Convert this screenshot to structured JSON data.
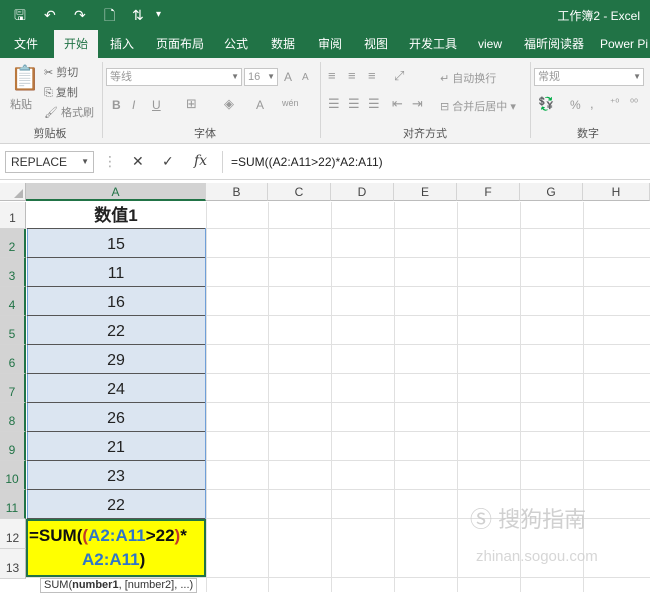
{
  "title": {
    "text": "工作簿2  -  Excel"
  },
  "tabs": [
    "文件",
    "开始",
    "插入",
    "页面布局",
    "公式",
    "数据",
    "审阅",
    "视图",
    "开发工具",
    "view",
    "福昕阅读器",
    "Power Pi"
  ],
  "ribbon": {
    "clipboard": {
      "paste": "粘贴",
      "cut": "剪切",
      "copy": "复制",
      "format_painter": "格式刷",
      "group": "剪贴板"
    },
    "font": {
      "name": "等线",
      "size": "16",
      "bold": "B",
      "italic": "I",
      "underline": "U",
      "grow": "A",
      "shrink": "A",
      "color": "A",
      "wen": "wén",
      "group": "字体"
    },
    "alignment": {
      "wrap": "自动换行",
      "merge": "合并后居中",
      "group": "对齐方式"
    },
    "number": {
      "format": "常规",
      "percent": "%",
      "group": "数字"
    }
  },
  "formula_bar": {
    "name_box": "REPLACE",
    "cancel": "✕",
    "enter": "✓",
    "fx": "fx",
    "formula": "=SUM((A2:A11>22)*A2:A11)"
  },
  "columns": [
    "A",
    "B",
    "C",
    "D",
    "E",
    "F",
    "G",
    "H"
  ],
  "rows": [
    "1",
    "2",
    "3",
    "4",
    "5",
    "6",
    "7",
    "8",
    "9",
    "10",
    "11",
    "12",
    "13"
  ],
  "cells": {
    "A1": "数值1",
    "values": [
      "15",
      "11",
      "16",
      "22",
      "29",
      "24",
      "26",
      "21",
      "23",
      "22"
    ]
  },
  "edit": {
    "p1": "=SUM(",
    "p2": "(",
    "p3": "A2:A11",
    "p4": ">22",
    "p5": ")",
    "p6": "*",
    "p7": "A2:A11",
    "p8": ")"
  },
  "tooltip": {
    "fn": "SUM(",
    "arg1": "number1",
    "rest": ", [number2], ...)"
  },
  "watermark": {
    "line1": "搜狗指南",
    "line2": "zhinan.sogou.com"
  },
  "colors": {
    "accent": "#217346",
    "selection": "#dbe5f1",
    "edit_bg": "#ffff00",
    "ref_blue": "#2e75c9",
    "paren_red": "#c0392b"
  }
}
